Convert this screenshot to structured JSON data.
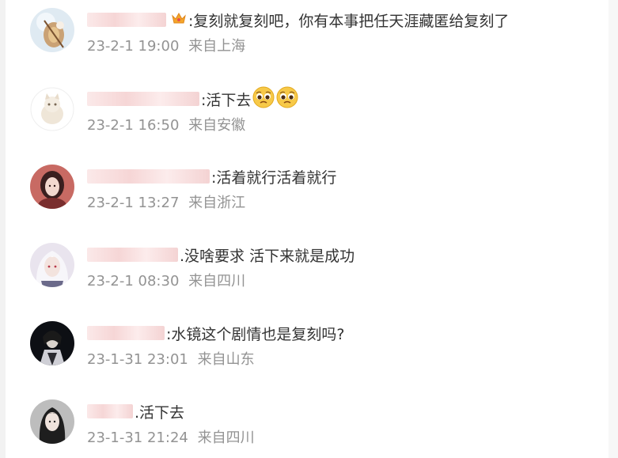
{
  "comments": [
    {
      "text": ":复刻就复刻吧，你有本事把任天涯藏匿给复刻了",
      "time": "23-2-1 19:00",
      "location": "来自上海",
      "has_badge": true,
      "avatar": "avatar-violin-icon"
    },
    {
      "text": ":活下去",
      "time": "23-2-1 16:50",
      "location": "来自安徽",
      "emoji_count": 2,
      "avatar": "avatar-cat-icon"
    },
    {
      "text": ":活着就行活着就行",
      "time": "23-2-1 13:27",
      "location": "来自浙江",
      "avatar": "avatar-girl-red-icon"
    },
    {
      "text": ".没啥要求 活下来就是成功",
      "time": "23-2-1 08:30",
      "location": "来自四川",
      "avatar": "avatar-white-hair-icon"
    },
    {
      "text": ":水镜这个剧情也是复刻吗?",
      "time": "23-1-31 23:01",
      "location": "来自山东",
      "avatar": "avatar-dark-figure-icon"
    },
    {
      "text": ".活下去",
      "time": "23-1-31 21:24",
      "location": "来自四川",
      "avatar": "avatar-girl-black-icon"
    }
  ],
  "colors": {
    "text": "#333333",
    "meta": "#939393",
    "username_blur": "#f6d6d6",
    "emoji": "#f5c542"
  }
}
